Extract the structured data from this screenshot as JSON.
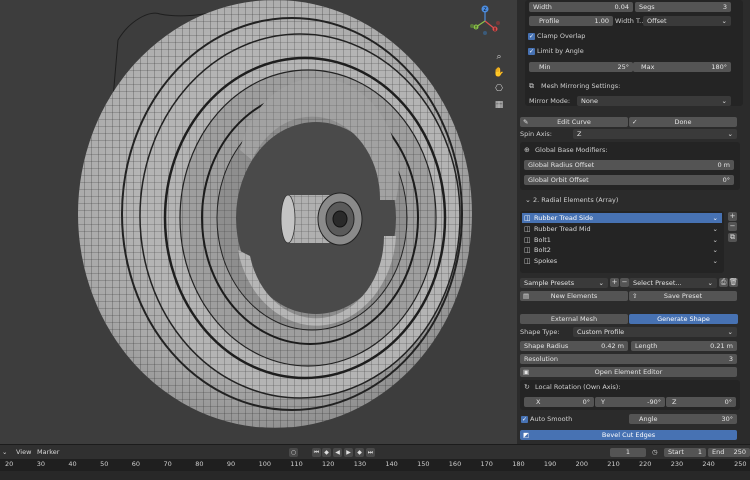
{
  "panel": {
    "width_label": "Width",
    "width_value": "0.04",
    "segs_label": "Segs",
    "segs_value": "3",
    "profile_label": "Profile",
    "profile_value": "1.00",
    "width_type_label": "Width T...",
    "width_type_value": "Offset",
    "clamp_overlap": "Clamp Overlap",
    "limit_by_angle": "Limit by Angle",
    "min_label": "Min",
    "min_value": "25°",
    "max_label": "Max",
    "max_value": "180°",
    "mesh_mirroring": "Mesh Mirroring Settings:",
    "mirror_mode_label": "Mirror Mode:",
    "mirror_mode_value": "None",
    "edit_curve": "Edit Curve",
    "done": "Done",
    "spin_axis_label": "Spin Axis:",
    "spin_axis_value": "Z",
    "global_base_modifiers": "Global Base Modifiers:",
    "global_radius_offset_label": "Global Radius Offset",
    "global_radius_offset_value": "0 m",
    "global_orbit_offset_label": "Global Orbit Offset",
    "global_orbit_offset_value": "0°",
    "radial_section": "2. Radial Elements (Array)",
    "list_items": [
      "Rubber Tread Side",
      "Rubber Tread Mid",
      "Bolt1",
      "Bolt2",
      "Spokes"
    ],
    "sample_presets": "Sample Presets",
    "select_preset": "Select Preset...",
    "new_elements": "New Elements",
    "save_preset": "Save Preset",
    "external_mesh": "External Mesh",
    "generate_shape": "Generate Shape",
    "shape_type_label": "Shape Type:",
    "shape_type_value": "Custom Profile",
    "shape_radius_label": "Shape Radius",
    "shape_radius_value": "0.42 m",
    "length_label": "Length",
    "length_value": "0.21 m",
    "resolution_label": "Resolution",
    "resolution_value": "3",
    "open_element_editor": "Open Element Editor",
    "local_rotation": "Local Rotation (Own Axis):",
    "x_label": "X",
    "x_value": "0°",
    "y_label": "Y",
    "y_value": "-90°",
    "z_label": "Z",
    "z_value": "0°",
    "auto_smooth": "Auto Smooth",
    "angle_label": "Angle",
    "angle_value": "30°",
    "bevel_cut_edges": "Bevel Cut Edges"
  },
  "timeline": {
    "menu_view": "View",
    "menu_marker": "Marker",
    "current_frame": "1",
    "start_label": "Start",
    "start_value": "1",
    "end_label": "End",
    "end_value": "250",
    "ticks": [
      "20",
      "30",
      "40",
      "50",
      "60",
      "70",
      "80",
      "90",
      "100",
      "110",
      "120",
      "130",
      "140",
      "150",
      "160",
      "170",
      "180",
      "190",
      "200",
      "210",
      "220",
      "230",
      "240",
      "250"
    ]
  },
  "viewport": {
    "axis_z": "Z",
    "axis_y": "Y",
    "axis_x": "X"
  }
}
